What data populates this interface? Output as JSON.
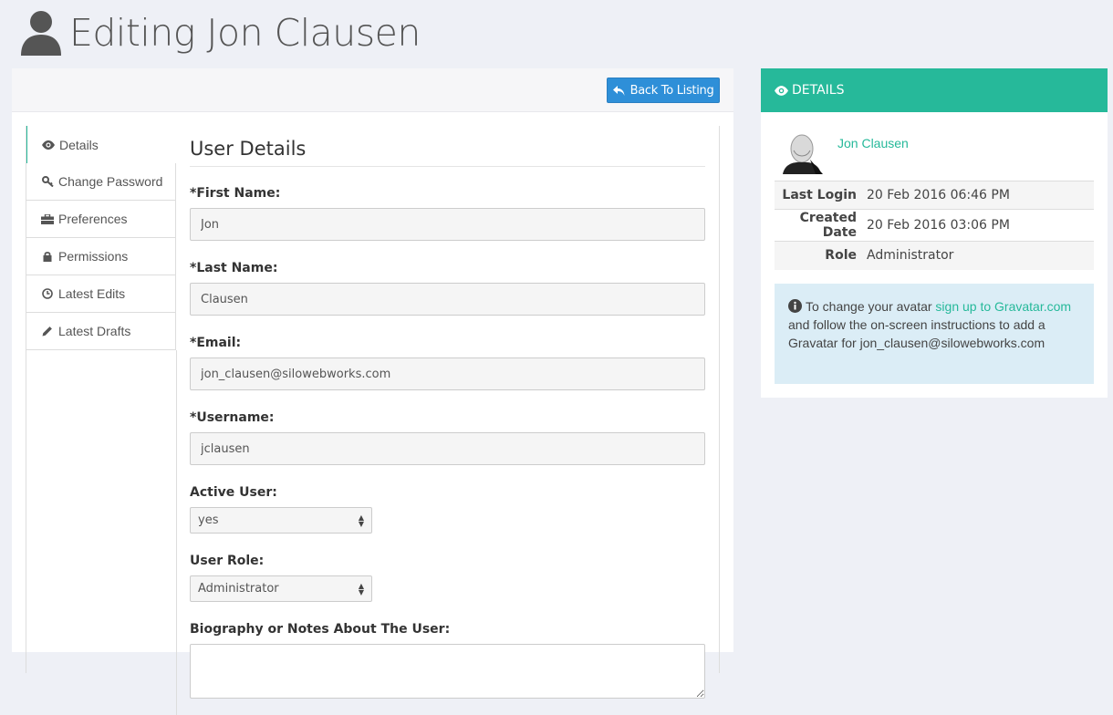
{
  "header": {
    "title": "Editing Jon Clausen",
    "icon": "user-icon"
  },
  "toolbar": {
    "back_label": "Back To Listing",
    "back_icon": "reply-icon"
  },
  "tabs": [
    {
      "label": "Details",
      "icon": "eye-icon",
      "active": true
    },
    {
      "label": "Change Password",
      "icon": "key-icon"
    },
    {
      "label": "Preferences",
      "icon": "briefcase-icon"
    },
    {
      "label": "Permissions",
      "icon": "lock-icon"
    },
    {
      "label": "Latest Edits",
      "icon": "clock-icon"
    },
    {
      "label": "Latest Drafts",
      "icon": "pencil-icon"
    }
  ],
  "form": {
    "title": "User Details",
    "first_name": {
      "label": "*First Name:",
      "value": "Jon"
    },
    "last_name": {
      "label": "*Last Name:",
      "value": "Clausen"
    },
    "email": {
      "label": "*Email:",
      "value": "jon_clausen@silowebworks.com"
    },
    "username": {
      "label": "*Username:",
      "value": "jclausen"
    },
    "active": {
      "label": "Active User:",
      "value": "yes"
    },
    "role": {
      "label": "User Role:",
      "value": "Administrator"
    },
    "bio": {
      "label": "Biography or Notes About The User:",
      "value": ""
    }
  },
  "details": {
    "header": "DETAILS",
    "header_icon": "eye-icon",
    "name": "Jon Clausen",
    "rows": [
      {
        "key": "Last Login",
        "value": "20 Feb 2016 06:46 PM"
      },
      {
        "key": "Created Date",
        "value": "20 Feb 2016 03:06 PM"
      },
      {
        "key": "Role",
        "value": "Administrator"
      }
    ],
    "avatar_note": {
      "prefix": "To change your avatar ",
      "link": "sign up to Gravatar.com",
      "suffix": " and follow the on-screen instructions to add a Gravatar for jon_clausen@silowebworks.com"
    }
  },
  "colors": {
    "accent": "#26b99a",
    "primary": "#2e8fd8",
    "info_bg": "#dbedf6",
    "page_bg": "#eef0f6"
  }
}
